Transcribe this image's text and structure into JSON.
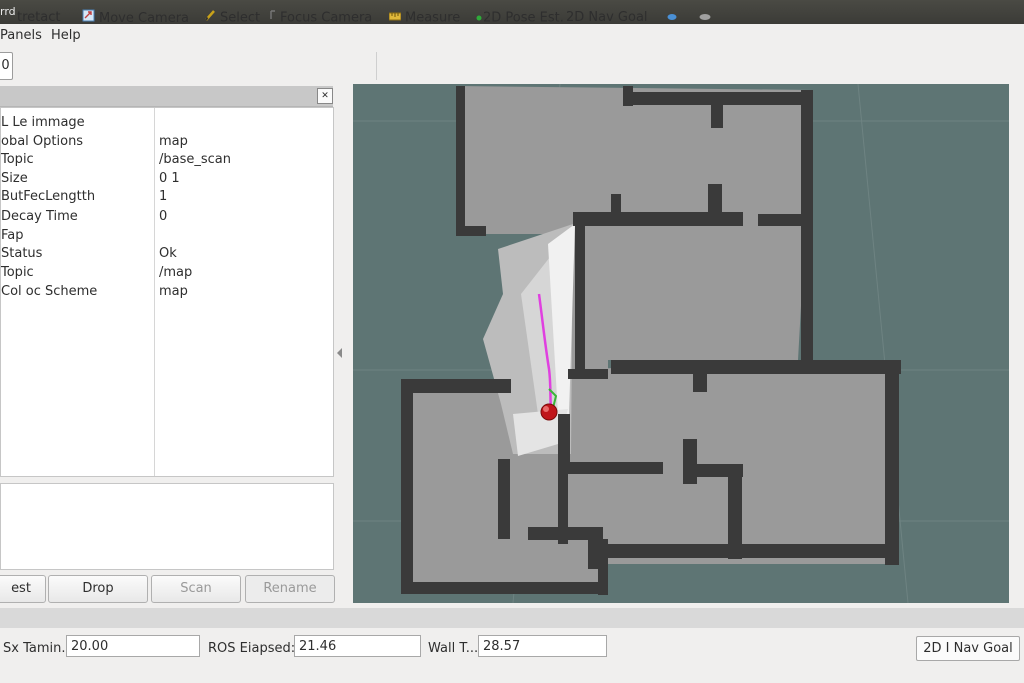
{
  "window": {
    "title": "rrd"
  },
  "menu": {
    "panels": "Panels",
    "help": "Help"
  },
  "toolbar": {
    "number_value": "0",
    "interact": "tretact",
    "move_camera": "Move Camera",
    "select": "Select",
    "focus_camera": "Focus Camera",
    "measure": "Measure",
    "pose_estimate": "2D Pose Est.",
    "nav_goal": "2D Nav Goal"
  },
  "properties": {
    "rows": [
      {
        "key": "L Le immage",
        "value": ""
      },
      {
        "key": "obal Options",
        "value": "map"
      },
      {
        "key": "Topic",
        "value": "/base_scan"
      },
      {
        "key": "Size",
        "value": "0 1"
      },
      {
        "key": "ButFecLengtth",
        "value": "1"
      },
      {
        "key": "Decay Time",
        "value": "0"
      },
      {
        "key": "Fap",
        "value": ""
      },
      {
        "key": "Status",
        "value": "Ok"
      },
      {
        "key": "Topic",
        "value": "/map"
      },
      {
        "key": "Col oc Scheme",
        "value": "map"
      }
    ]
  },
  "panel_buttons": {
    "test": "est",
    "drop": "Drop",
    "scan": "Scan",
    "rename": "Rename"
  },
  "bottom": {
    "sim_label": "Sx Tamin.",
    "sim_value": "20.00",
    "ros_label": "ROS Eiapsed:",
    "ros_value": "21.46",
    "wall_label": "Wall T...",
    "wall_value": "28.57",
    "nav_goal": "2D I Nav Goal"
  },
  "colors": {
    "viewport_bg": "#5e7574",
    "free_space": "#9a9a9a",
    "walls": "#3a3a3a",
    "laser_path": "#e040e0",
    "robot": "#c0151a"
  }
}
